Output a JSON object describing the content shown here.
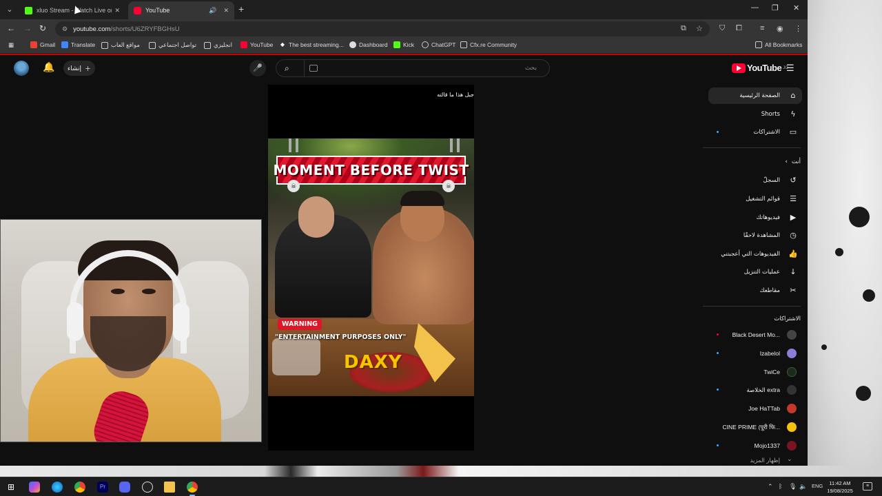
{
  "browser": {
    "tabs": [
      {
        "title": "xluo Stream - Watch Live on Kick",
        "favicon": "kick-icon"
      },
      {
        "title": "YouTube",
        "favicon": "youtube-icon"
      }
    ],
    "address": {
      "host": "youtube.com",
      "path": "/shorts/U6ZRYFBGHsU"
    },
    "bookmarks": [
      {
        "label": "Gmail",
        "icon": "gmail-icon"
      },
      {
        "label": "Translate",
        "icon": "translate-icon"
      },
      {
        "label": "مواقع العاب",
        "icon": "folder-icon"
      },
      {
        "label": "تواصل اجتماعي",
        "icon": "folder-icon"
      },
      {
        "label": "انجليزي",
        "icon": "folder-icon"
      },
      {
        "label": "YouTube",
        "icon": "youtube-icon"
      },
      {
        "label": "The best streaming...",
        "icon": "diamond-icon"
      },
      {
        "label": "Dashboard",
        "icon": "discord-icon"
      },
      {
        "label": "Kick",
        "icon": "kick-icon"
      },
      {
        "label": "ChatGPT",
        "icon": "chatgpt-icon"
      },
      {
        "label": "Cfx.re Community",
        "icon": "cfx-icon"
      }
    ],
    "all_bookmarks": "All Bookmarks"
  },
  "youtube": {
    "create_label": "إنشاء",
    "search_placeholder": "بحث",
    "logo_text": "YouTube",
    "logo_country": "JO",
    "short": {
      "caption": "جبل هذا ما قالته",
      "title_banner": "MOMENT BEFORE TWIST",
      "warning_badge": "WARNING",
      "warning_text": "\"ENTERTAINMENT PURPOSES ONLY\"",
      "watermark": "DAXY"
    },
    "sidebar": {
      "main": [
        {
          "label": "الصفحة الرئيسية",
          "icon": "home-icon"
        },
        {
          "label": "Shorts",
          "icon": "shorts-icon"
        },
        {
          "label": "الاشتراكات",
          "icon": "subscriptions-icon"
        }
      ],
      "you_heading": "أنت",
      "you": [
        {
          "label": "السجلّ",
          "icon": "history-icon"
        },
        {
          "label": "قوائم التشغيل",
          "icon": "playlists-icon"
        },
        {
          "label": "فيديوهاتك",
          "icon": "your-videos-icon"
        },
        {
          "label": "المشاهدة لاحقًا",
          "icon": "watch-later-icon"
        },
        {
          "label": "الفيديوهات التي أعجبتني",
          "icon": "like-icon"
        },
        {
          "label": "عمليات التنزيل",
          "icon": "download-icon"
        },
        {
          "label": "مقاطعك",
          "icon": "clips-icon"
        }
      ],
      "subs_heading": "الاشتراكات",
      "subscriptions": [
        {
          "label": "Black Desert Mo...",
          "avatar_color": "#444444",
          "live": true
        },
        {
          "label": "Izabelol",
          "avatar_color": "#8a7fd8",
          "live": true
        },
        {
          "label": "TwiCe",
          "avatar_color": "#1c2a1c",
          "live": false
        },
        {
          "label": "الخلاصة extra",
          "avatar_color": "#333333",
          "live": true
        },
        {
          "label": "Joe HaTTab",
          "avatar_color": "#c0392b",
          "live": false
        },
        {
          "label": "CINE PRIME (पूरी फि...",
          "avatar_color": "#f4c20d",
          "live": false
        },
        {
          "label": "Mojo1337",
          "avatar_color": "#7a1420",
          "live": true
        }
      ],
      "show_more": "إظهار المزيد"
    }
  },
  "taskbar": {
    "apps": [
      "windows-start-icon",
      "copilot-icon",
      "edge-icon",
      "chrome-icon",
      "premiere-icon",
      "discord-icon",
      "obs-icon",
      "explorer-icon",
      "chrome-active-icon"
    ],
    "lang": "ENG",
    "time": "11:42 AM",
    "date": "19/08/2025"
  }
}
